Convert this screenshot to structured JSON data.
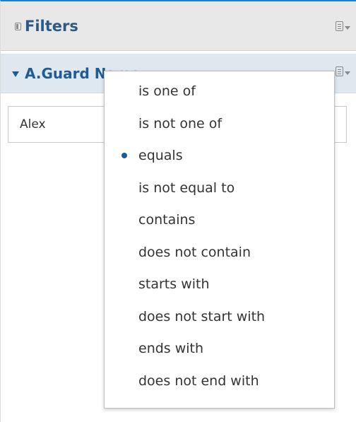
{
  "header": {
    "title": "Filters",
    "panel_icon": "panel-icon",
    "menu_icon": "panel-menu-icon"
  },
  "filter": {
    "title": "A.Guard Name",
    "menu_icon": "filter-menu-icon",
    "value": "Alex"
  },
  "dropdown": {
    "selected_index": 2,
    "options": [
      {
        "label": "is one of"
      },
      {
        "label": "is not one of"
      },
      {
        "label": "equals"
      },
      {
        "label": "is not equal to"
      },
      {
        "label": "contains"
      },
      {
        "label": "does not contain"
      },
      {
        "label": "starts with"
      },
      {
        "label": "does not start with"
      },
      {
        "label": "ends with"
      },
      {
        "label": "does not end with"
      }
    ]
  },
  "colors": {
    "accent": "#1a7fd4",
    "title_text": "#1f5c96",
    "header_bg": "#e8e8e8",
    "filter_bg": "#dfe7ef"
  }
}
